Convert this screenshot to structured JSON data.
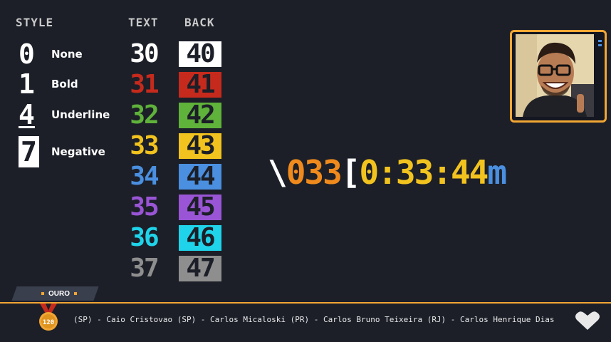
{
  "headers": {
    "style": "STYLE",
    "text": "TEXT",
    "back": "BACK"
  },
  "styles": [
    {
      "code": "0",
      "label": "None"
    },
    {
      "code": "1",
      "label": "Bold"
    },
    {
      "code": "4",
      "label": "Underline"
    },
    {
      "code": "7",
      "label": "Negative"
    }
  ],
  "colors": [
    {
      "text": "30",
      "back": "40",
      "hex": "#ffffff"
    },
    {
      "text": "31",
      "back": "41",
      "hex": "#c62a1c"
    },
    {
      "text": "32",
      "back": "42",
      "hex": "#5fb23a"
    },
    {
      "text": "33",
      "back": "43",
      "hex": "#f2c31e"
    },
    {
      "text": "34",
      "back": "44",
      "hex": "#4a8fe0"
    },
    {
      "text": "35",
      "back": "45",
      "hex": "#9a55d6"
    },
    {
      "text": "36",
      "back": "46",
      "hex": "#1fd4ea"
    },
    {
      "text": "37",
      "back": "47",
      "hex": "#8e8e8e"
    }
  ],
  "sequence": {
    "escape": "\\",
    "octal": "033",
    "bracket": "[",
    "params": "0:33:44",
    "terminator": "m"
  },
  "sequence_colors": {
    "escape": "#ffffff",
    "octal": "#f08a1c",
    "bracket": "#ffffff",
    "params": "#f2c31e",
    "terminator": "#4a8fe0"
  },
  "tier": {
    "label": "OURO",
    "badge": "120",
    "accent": "#f2a634"
  },
  "ticker": "(SP) - Caio Cristovao (SP) - Carlos Micaloski (PR) - Carlos Bruno Teixeira (RJ) - Carlos Henrique Dias"
}
